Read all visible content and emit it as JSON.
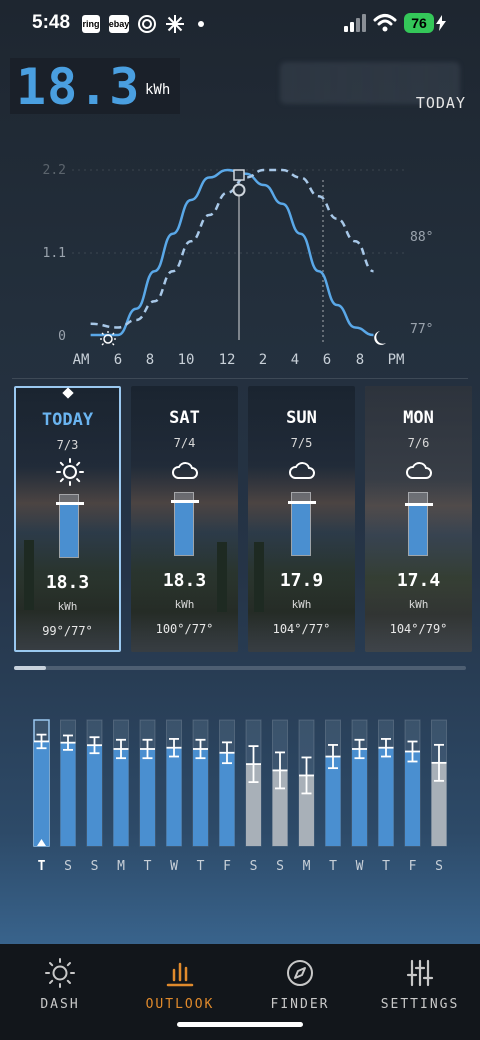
{
  "status": {
    "time": "5:48",
    "apps": [
      "ring",
      "ebay"
    ],
    "battery": "76"
  },
  "header": {
    "energy_value": "18.3",
    "energy_unit": "kWh",
    "period_label": "TODAY"
  },
  "chart_data": {
    "type": "line",
    "y_ticks": [
      "2.2",
      "1.1",
      "0"
    ],
    "x_ticks": [
      "AM",
      "6",
      "8",
      "10",
      "12",
      "2",
      "4",
      "6",
      "8",
      "PM"
    ],
    "temp_ticks": [
      "88°",
      "77°"
    ],
    "series": [
      {
        "x": [
          4.5,
          6,
          7,
          8,
          9,
          10,
          11,
          12,
          13,
          14,
          15,
          16,
          17,
          18,
          19,
          20
        ],
        "values": [
          0,
          0,
          0.35,
          0.85,
          1.35,
          1.8,
          2.1,
          2.2,
          2.15,
          2.0,
          1.75,
          1.35,
          0.85,
          0.4,
          0.1,
          0
        ]
      },
      {
        "x": [
          4.5,
          6,
          7,
          8,
          9,
          10,
          11,
          12,
          13,
          14,
          15,
          16,
          17,
          18,
          19,
          20
        ],
        "values": [
          0.15,
          0.1,
          0.2,
          0.45,
          0.85,
          1.25,
          1.6,
          1.9,
          2.1,
          2.2,
          2.2,
          2.1,
          1.85,
          1.55,
          1.25,
          0.85
        ]
      }
    ]
  },
  "forecast": [
    {
      "day": "TODAY",
      "date": "7/3",
      "icon": "sun-icon",
      "value": "18.3",
      "unit": "kWh",
      "temps": "99°/77°",
      "level": 0.85
    },
    {
      "day": "SAT",
      "date": "7/4",
      "icon": "cloud-icon",
      "value": "18.3",
      "unit": "kWh",
      "temps": "100°/77°",
      "level": 0.85
    },
    {
      "day": "SUN",
      "date": "7/5",
      "icon": "cloud-icon",
      "value": "17.9",
      "unit": "kWh",
      "temps": "104°/77°",
      "level": 0.83
    },
    {
      "day": "MON",
      "date": "7/6",
      "icon": "cloud-icon",
      "value": "17.4",
      "unit": "kWh",
      "temps": "104°/79°",
      "level": 0.8
    }
  ],
  "bars": {
    "labels": [
      "T",
      "S",
      "S",
      "M",
      "T",
      "W",
      "T",
      "F",
      "S",
      "S",
      "M",
      "T",
      "W",
      "T",
      "F",
      "S"
    ],
    "levels": [
      0.83,
      0.82,
      0.8,
      0.77,
      0.77,
      0.78,
      0.77,
      0.74,
      0.65,
      0.6,
      0.56,
      0.71,
      0.77,
      0.78,
      0.75,
      0.66
    ],
    "highlighted": [
      true,
      true,
      true,
      true,
      true,
      true,
      true,
      true,
      false,
      false,
      false,
      true,
      true,
      true,
      true,
      false
    ]
  },
  "tabs": [
    {
      "label": "DASH",
      "icon": "sun-icon"
    },
    {
      "label": "OUTLOOK",
      "icon": "bar-chart-icon"
    },
    {
      "label": "FINDER",
      "icon": "compass-icon"
    },
    {
      "label": "SETTINGS",
      "icon": "sliders-icon"
    }
  ],
  "colors": {
    "accent": "#4a9fe0",
    "active_tab": "#e08a2c",
    "bar_highlight": "#4a8fd0",
    "bar_muted": "#a8b0b8"
  }
}
